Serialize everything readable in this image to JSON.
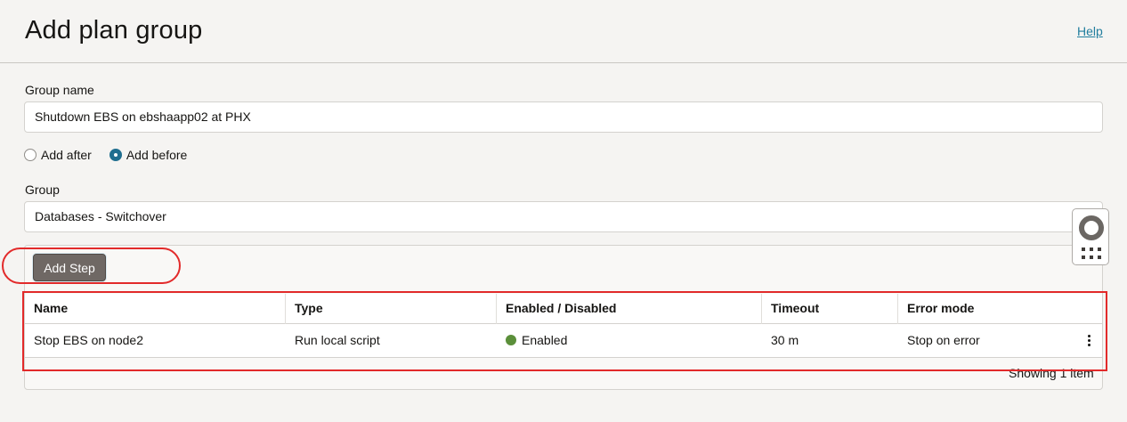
{
  "header": {
    "title": "Add plan group",
    "help_label": "Help"
  },
  "form": {
    "group_name_label": "Group name",
    "group_name_value": "Shutdown EBS on ebshaapp02 at PHX",
    "position_options": [
      {
        "label": "Add after",
        "selected": false
      },
      {
        "label": "Add before",
        "selected": true
      }
    ],
    "group_label": "Group",
    "group_value": "Databases - Switchover"
  },
  "steps": {
    "add_step_label": "Add Step",
    "columns": [
      "Name",
      "Type",
      "Enabled / Disabled",
      "Timeout",
      "Error mode"
    ],
    "rows": [
      {
        "name": "Stop EBS on node2",
        "type": "Run local script",
        "enabled": "Enabled",
        "timeout": "30 m",
        "error_mode": "Stop on error"
      }
    ],
    "status_color": "#5b8f3a",
    "footer": "Showing 1 item"
  },
  "help_widget": {
    "icons": [
      "lifebuoy-icon",
      "grid-icon"
    ]
  },
  "annotation_color": "#e22a2a"
}
